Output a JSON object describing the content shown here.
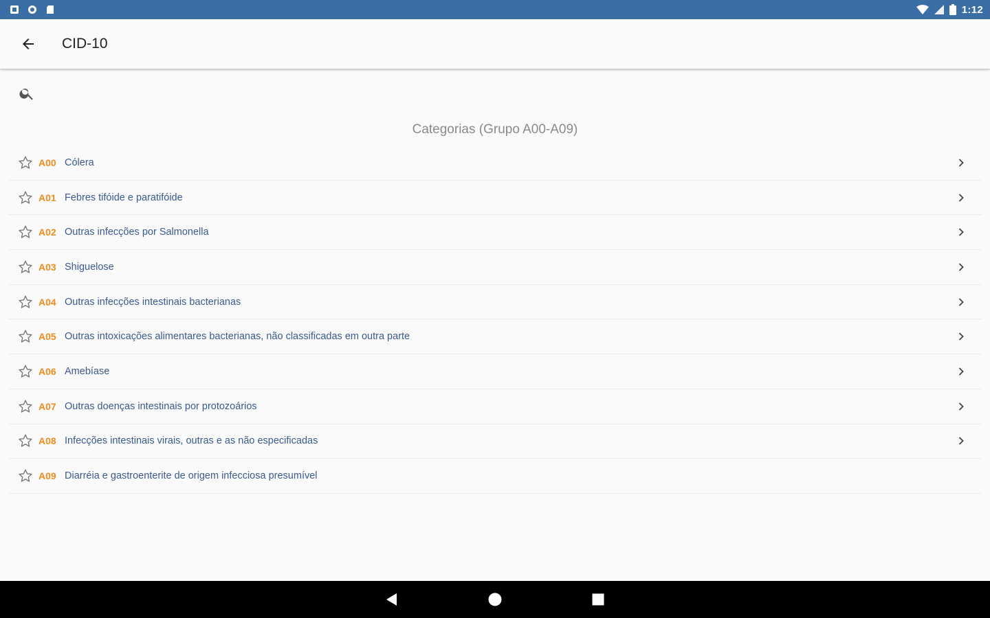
{
  "status_bar": {
    "time": "1:12",
    "left_icons": [
      "notification-icon",
      "sync-icon",
      "sd-card-icon"
    ],
    "right_icons": [
      "wifi-icon",
      "signal-icon",
      "battery-icon"
    ],
    "background": "#3b6ea5"
  },
  "app_bar": {
    "title": "CID-10",
    "back_icon": "arrow-left-icon"
  },
  "search": {
    "icon": "search-icon",
    "value": "",
    "placeholder": ""
  },
  "section_title": "Categorias (Grupo A00-A09)",
  "colors": {
    "code": "#f08c1b",
    "label": "#3a5a8c",
    "section_title": "#8a8a8a"
  },
  "items": [
    {
      "code": "A00",
      "label": "Cólera",
      "favorite": false,
      "has_children": true
    },
    {
      "code": "A01",
      "label": "Febres tifóide e paratifóide",
      "favorite": false,
      "has_children": true
    },
    {
      "code": "A02",
      "label": "Outras infecções por Salmonella",
      "favorite": false,
      "has_children": true
    },
    {
      "code": "A03",
      "label": "Shiguelose",
      "favorite": false,
      "has_children": true
    },
    {
      "code": "A04",
      "label": "Outras infecções intestinais bacterianas",
      "favorite": false,
      "has_children": true
    },
    {
      "code": "A05",
      "label": "Outras intoxicações alimentares bacterianas, não classificadas em outra parte",
      "favorite": false,
      "has_children": true
    },
    {
      "code": "A06",
      "label": "Amebíase",
      "favorite": false,
      "has_children": true
    },
    {
      "code": "A07",
      "label": "Outras doenças intestinais por protozoários",
      "favorite": false,
      "has_children": true
    },
    {
      "code": "A08",
      "label": "Infecções intestinais virais, outras e as não especificadas",
      "favorite": false,
      "has_children": true
    },
    {
      "code": "A09",
      "label": "Diarréia e gastroenterite de origem infecciosa presumível",
      "favorite": false,
      "has_children": false
    }
  ],
  "nav_bar": {
    "buttons": [
      "back-triangle-icon",
      "home-circle-icon",
      "recents-square-icon"
    ]
  }
}
